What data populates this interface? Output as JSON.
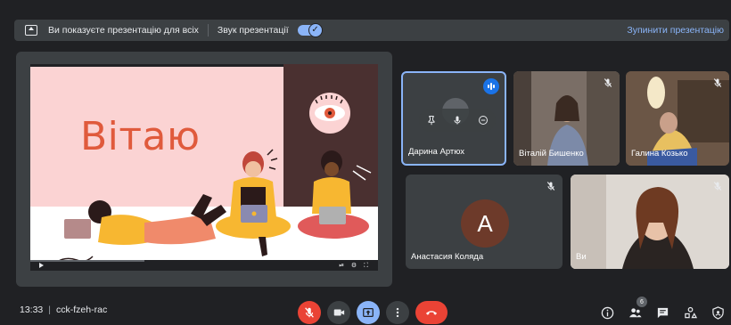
{
  "banner": {
    "presenting_text": "Ви показуєте презентацію для всіх",
    "sound_label": "Звук презентації",
    "sound_on": true,
    "stop_label": "Зупинити презентацію"
  },
  "slide": {
    "title": "Вітаю",
    "controls_text": "⏯ ⚙ ⛶"
  },
  "participants": [
    {
      "name": "Дарина Артюх",
      "speaking": true,
      "muted": false,
      "active": true
    },
    {
      "name": "Віталій Бишенко",
      "muted": true
    },
    {
      "name": "Галина Козько",
      "muted": true
    },
    {
      "name": "Анастасия Коляда",
      "initial": "А",
      "avatar_color": "#6d3a2a",
      "muted": true
    },
    {
      "name": "Ви",
      "muted": true
    }
  ],
  "footer": {
    "time": "13:33",
    "meeting_code": "cck-fzeh-rac",
    "people_count": "6"
  },
  "colors": {
    "accent": "#8ab4f8",
    "end_call": "#ea4335",
    "mic_off": "#ea4335",
    "present": "#8ab4f8"
  }
}
